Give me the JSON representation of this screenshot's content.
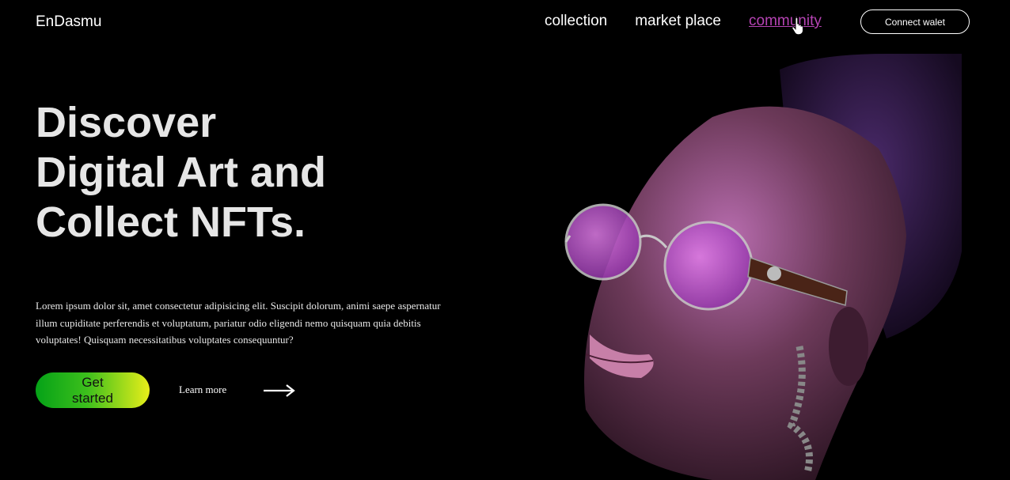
{
  "header": {
    "logo": "EnDasmu",
    "nav": [
      {
        "label": "collection",
        "active": false
      },
      {
        "label": "market place",
        "active": false
      },
      {
        "label": "community",
        "active": true
      }
    ],
    "connect_label": "Connect walet"
  },
  "hero": {
    "title_lines": [
      "Discover",
      "Digital Art and",
      "Collect NFTs."
    ],
    "description": "Lorem ipsum dolor sit, amet consectetur adipisicing elit. Suscipit dolorum, animi saepe aspernatur illum cupiditate perferendis et voluptatum, pariatur odio eligendi nemo quisquam quia debitis voluptates! Quisquam necessitatibus voluptates consequuntur?",
    "cta_label": "Get started",
    "learn_label": "Learn more"
  },
  "icons": {
    "cursor": "hand-pointer-icon",
    "arrow": "arrow-right-icon"
  },
  "colors": {
    "background": "#000000",
    "active_nav": "#b543b3",
    "cta_gradient_start": "#05a217",
    "cta_gradient_end": "#e8ee1a",
    "title": "#e6e6e6"
  }
}
